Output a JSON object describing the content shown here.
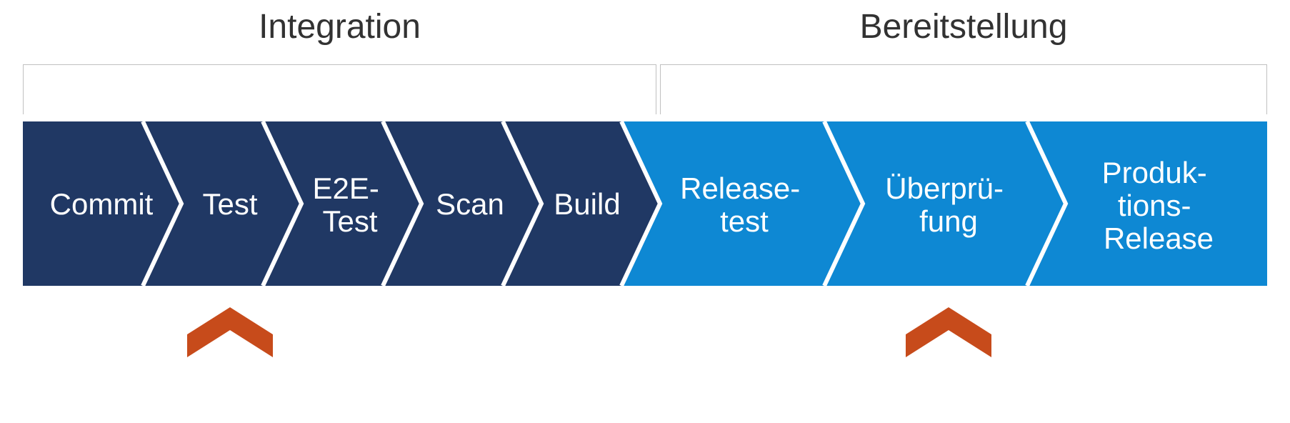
{
  "phases": {
    "integration": {
      "label": "Integration"
    },
    "deployment": {
      "label": "Bereitstellung"
    }
  },
  "stages": {
    "s1": {
      "label": "Commit",
      "phase": "integration"
    },
    "s2": {
      "label": "Test",
      "phase": "integration"
    },
    "s3": {
      "label": "E2E-\nTest",
      "phase": "integration"
    },
    "s4": {
      "label": "Scan",
      "phase": "integration"
    },
    "s5": {
      "label": "Build",
      "phase": "integration"
    },
    "s6": {
      "label": "Release-\ntest",
      "phase": "deployment"
    },
    "s7": {
      "label": "Überprü-\nfung",
      "phase": "deployment"
    },
    "s8": {
      "label": "Produk-\ntions-\nRelease",
      "phase": "deployment"
    }
  },
  "colors": {
    "integration": "#203864",
    "deployment": "#0e88d3",
    "marker": "#c74b1b",
    "stroke": "#ffffff"
  },
  "markers": {
    "m1": {
      "stage": "s2"
    },
    "m2": {
      "stage": "s7"
    }
  }
}
